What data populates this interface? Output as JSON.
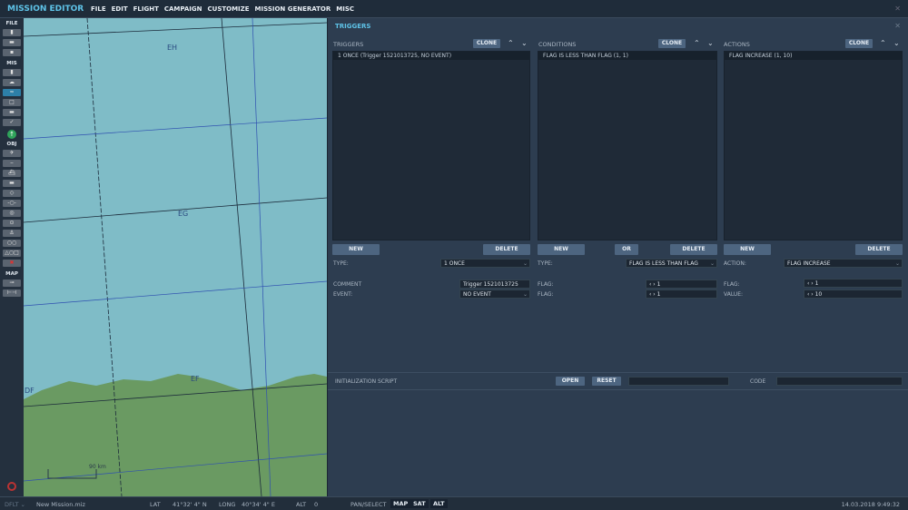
{
  "app": {
    "title": "MISSION EDITOR",
    "menu": [
      "FILE",
      "EDIT",
      "FLIGHT",
      "CAMPAIGN",
      "CUSTOMIZE",
      "MISSION GENERATOR",
      "MISC"
    ]
  },
  "sidebar": {
    "file_label": "FILE",
    "mis_label": "MIS",
    "obj_label": "OBJ",
    "map_label": "MAP"
  },
  "map": {
    "grid_labels": [
      "EH",
      "EG",
      "EF",
      "DF"
    ],
    "scale_label": "90 km",
    "land_color": "#6a9a62",
    "sea_color": "#7fbcc7"
  },
  "panel": {
    "title": "TRIGGERS",
    "triggers": {
      "label": "TRIGGERS",
      "clone": "CLONE",
      "items": [
        "1 ONCE (Trigger 1521013725, NO EVENT)"
      ],
      "new": "NEW",
      "delete": "DELETE",
      "type_label": "TYPE:",
      "type_value": "1 ONCE",
      "comment_label": "COMMENT",
      "comment_value": "Trigger 1521013725",
      "event_label": "EVENT:",
      "event_value": "NO EVENT"
    },
    "conditions": {
      "label": "CONDITIONS",
      "clone": "CLONE",
      "items": [
        "FLAG IS LESS THAN FLAG (1, 1)"
      ],
      "new": "NEW",
      "or": "OR",
      "delete": "DELETE",
      "type_label": "TYPE:",
      "type_value": "FLAG IS LESS THAN FLAG",
      "flag1_label": "FLAG:",
      "flag1_value": "‹ › 1",
      "flag2_label": "FLAG:",
      "flag2_value": "‹ › 1"
    },
    "actions": {
      "label": "ACTIONS",
      "clone": "CLONE",
      "items": [
        "FLAG INCREASE (1, 10)"
      ],
      "new": "NEW",
      "delete": "DELETE",
      "action_label": "ACTION:",
      "action_value": "FLAG INCREASE",
      "flag_label": "FLAG:",
      "flag_value": "‹ › 1",
      "value_label": "VALUE:",
      "value_value": "‹ › 10"
    },
    "init": {
      "label": "INITIALIZATION SCRIPT",
      "open": "OPEN",
      "reset": "RESET",
      "code_label": "CODE",
      "script_value": "",
      "code_value": ""
    }
  },
  "status": {
    "profile": "DFLT ⌄",
    "file": "New Mission.miz",
    "lat_label": "LAT",
    "lat": "41°32' 4\" N",
    "long_label": "LONG",
    "long": "40°34' 4\" E",
    "alt_label": "ALT",
    "alt": "0",
    "pan": "PAN/SELECT",
    "map_btn": "MAP",
    "sat_btn": "SAT",
    "alt_btn": "ALT",
    "datetime": "14.03.2018 9:49:32"
  }
}
